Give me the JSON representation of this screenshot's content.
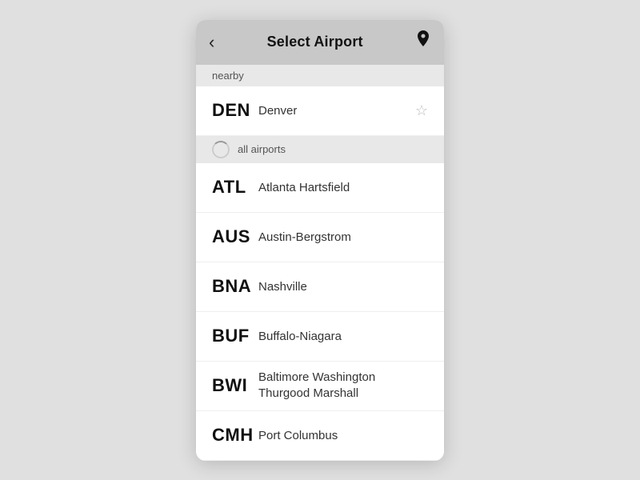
{
  "header": {
    "back_label": "‹",
    "title": "Select Airport",
    "location_icon": "📍"
  },
  "sections": {
    "nearby_label": "nearby",
    "all_airports_label": "all airports"
  },
  "nearby_airports": [
    {
      "code": "DEN",
      "name": "Denver",
      "starred": false
    }
  ],
  "all_airports": [
    {
      "code": "ATL",
      "name": "Atlanta Hartsfield"
    },
    {
      "code": "AUS",
      "name": "Austin-Bergstrom"
    },
    {
      "code": "BNA",
      "name": "Nashville"
    },
    {
      "code": "BUF",
      "name": "Buffalo-Niagara"
    },
    {
      "code": "BWI",
      "name": "Baltimore Washington\nThurgood Marshall"
    },
    {
      "code": "CMH",
      "name": "Port Columbus"
    }
  ]
}
